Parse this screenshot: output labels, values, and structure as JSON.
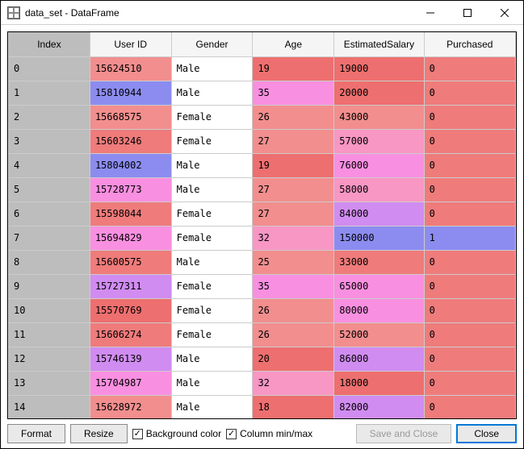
{
  "window": {
    "title": "data_set - DataFrame"
  },
  "columns": [
    "Index",
    "User ID",
    "Gender",
    "Age",
    "EstimatedSalary",
    "Purchased"
  ],
  "rows": [
    {
      "idx": "0",
      "uid": "15624510",
      "gen": "Male",
      "age": "19",
      "sal": "19000",
      "pur": "0",
      "c": {
        "uid": "#f28e8e",
        "gen": "#ffffff",
        "age": "#ee6f6f",
        "sal": "#ee6f6f",
        "pur": "#ef7b7b"
      }
    },
    {
      "idx": "1",
      "uid": "15810944",
      "gen": "Male",
      "age": "35",
      "sal": "20000",
      "pur": "0",
      "c": {
        "uid": "#8c8cf0",
        "gen": "#ffffff",
        "age": "#f98fe0",
        "sal": "#ee6f6f",
        "pur": "#ef7b7b"
      }
    },
    {
      "idx": "2",
      "uid": "15668575",
      "gen": "Female",
      "age": "26",
      "sal": "43000",
      "pur": "0",
      "c": {
        "uid": "#f28e8e",
        "gen": "#ffffff",
        "age": "#f28e8e",
        "sal": "#f28e8e",
        "pur": "#ef7b7b"
      }
    },
    {
      "idx": "3",
      "uid": "15603246",
      "gen": "Female",
      "age": "27",
      "sal": "57000",
      "pur": "0",
      "c": {
        "uid": "#ef7b7b",
        "gen": "#ffffff",
        "age": "#f28e8e",
        "sal": "#f896c4",
        "pur": "#ef7b7b"
      }
    },
    {
      "idx": "4",
      "uid": "15804002",
      "gen": "Male",
      "age": "19",
      "sal": "76000",
      "pur": "0",
      "c": {
        "uid": "#8c8cf0",
        "gen": "#ffffff",
        "age": "#ee6f6f",
        "sal": "#f98fe0",
        "pur": "#ef7b7b"
      }
    },
    {
      "idx": "5",
      "uid": "15728773",
      "gen": "Male",
      "age": "27",
      "sal": "58000",
      "pur": "0",
      "c": {
        "uid": "#f98fe0",
        "gen": "#ffffff",
        "age": "#f28e8e",
        "sal": "#f896c4",
        "pur": "#ef7b7b"
      }
    },
    {
      "idx": "6",
      "uid": "15598044",
      "gen": "Female",
      "age": "27",
      "sal": "84000",
      "pur": "0",
      "c": {
        "uid": "#ef7b7b",
        "gen": "#ffffff",
        "age": "#f28e8e",
        "sal": "#d08cf0",
        "pur": "#ef7b7b"
      }
    },
    {
      "idx": "7",
      "uid": "15694829",
      "gen": "Female",
      "age": "32",
      "sal": "150000",
      "pur": "1",
      "c": {
        "uid": "#f98fe0",
        "gen": "#ffffff",
        "age": "#f896c4",
        "sal": "#8c8cf0",
        "pur": "#8c8cf0"
      }
    },
    {
      "idx": "8",
      "uid": "15600575",
      "gen": "Male",
      "age": "25",
      "sal": "33000",
      "pur": "0",
      "c": {
        "uid": "#ef7b7b",
        "gen": "#ffffff",
        "age": "#f28e8e",
        "sal": "#ef7b7b",
        "pur": "#ef7b7b"
      }
    },
    {
      "idx": "9",
      "uid": "15727311",
      "gen": "Female",
      "age": "35",
      "sal": "65000",
      "pur": "0",
      "c": {
        "uid": "#d08cf0",
        "gen": "#ffffff",
        "age": "#f98fe0",
        "sal": "#f98fe0",
        "pur": "#ef7b7b"
      }
    },
    {
      "idx": "10",
      "uid": "15570769",
      "gen": "Female",
      "age": "26",
      "sal": "80000",
      "pur": "0",
      "c": {
        "uid": "#ee6f6f",
        "gen": "#ffffff",
        "age": "#f28e8e",
        "sal": "#f98fe0",
        "pur": "#ef7b7b"
      }
    },
    {
      "idx": "11",
      "uid": "15606274",
      "gen": "Female",
      "age": "26",
      "sal": "52000",
      "pur": "0",
      "c": {
        "uid": "#ef7b7b",
        "gen": "#ffffff",
        "age": "#f28e8e",
        "sal": "#f28e8e",
        "pur": "#ef7b7b"
      }
    },
    {
      "idx": "12",
      "uid": "15746139",
      "gen": "Male",
      "age": "20",
      "sal": "86000",
      "pur": "0",
      "c": {
        "uid": "#d08cf0",
        "gen": "#ffffff",
        "age": "#ee6f6f",
        "sal": "#d08cf0",
        "pur": "#ef7b7b"
      }
    },
    {
      "idx": "13",
      "uid": "15704987",
      "gen": "Male",
      "age": "32",
      "sal": "18000",
      "pur": "0",
      "c": {
        "uid": "#f98fe0",
        "gen": "#ffffff",
        "age": "#f896c4",
        "sal": "#ee6f6f",
        "pur": "#ef7b7b"
      }
    },
    {
      "idx": "14",
      "uid": "15628972",
      "gen": "Male",
      "age": "18",
      "sal": "82000",
      "pur": "0",
      "c": {
        "uid": "#f28e8e",
        "gen": "#ffffff",
        "age": "#ee6f6f",
        "sal": "#d08cf0",
        "pur": "#ef7b7b"
      }
    }
  ],
  "buttons": {
    "format": "Format",
    "resize": "Resize",
    "bgcolor": "Background color",
    "colminmax": "Column min/max",
    "saveclose": "Save and Close",
    "close": "Close"
  },
  "checkboxes": {
    "bgcolor": true,
    "colminmax": true
  }
}
